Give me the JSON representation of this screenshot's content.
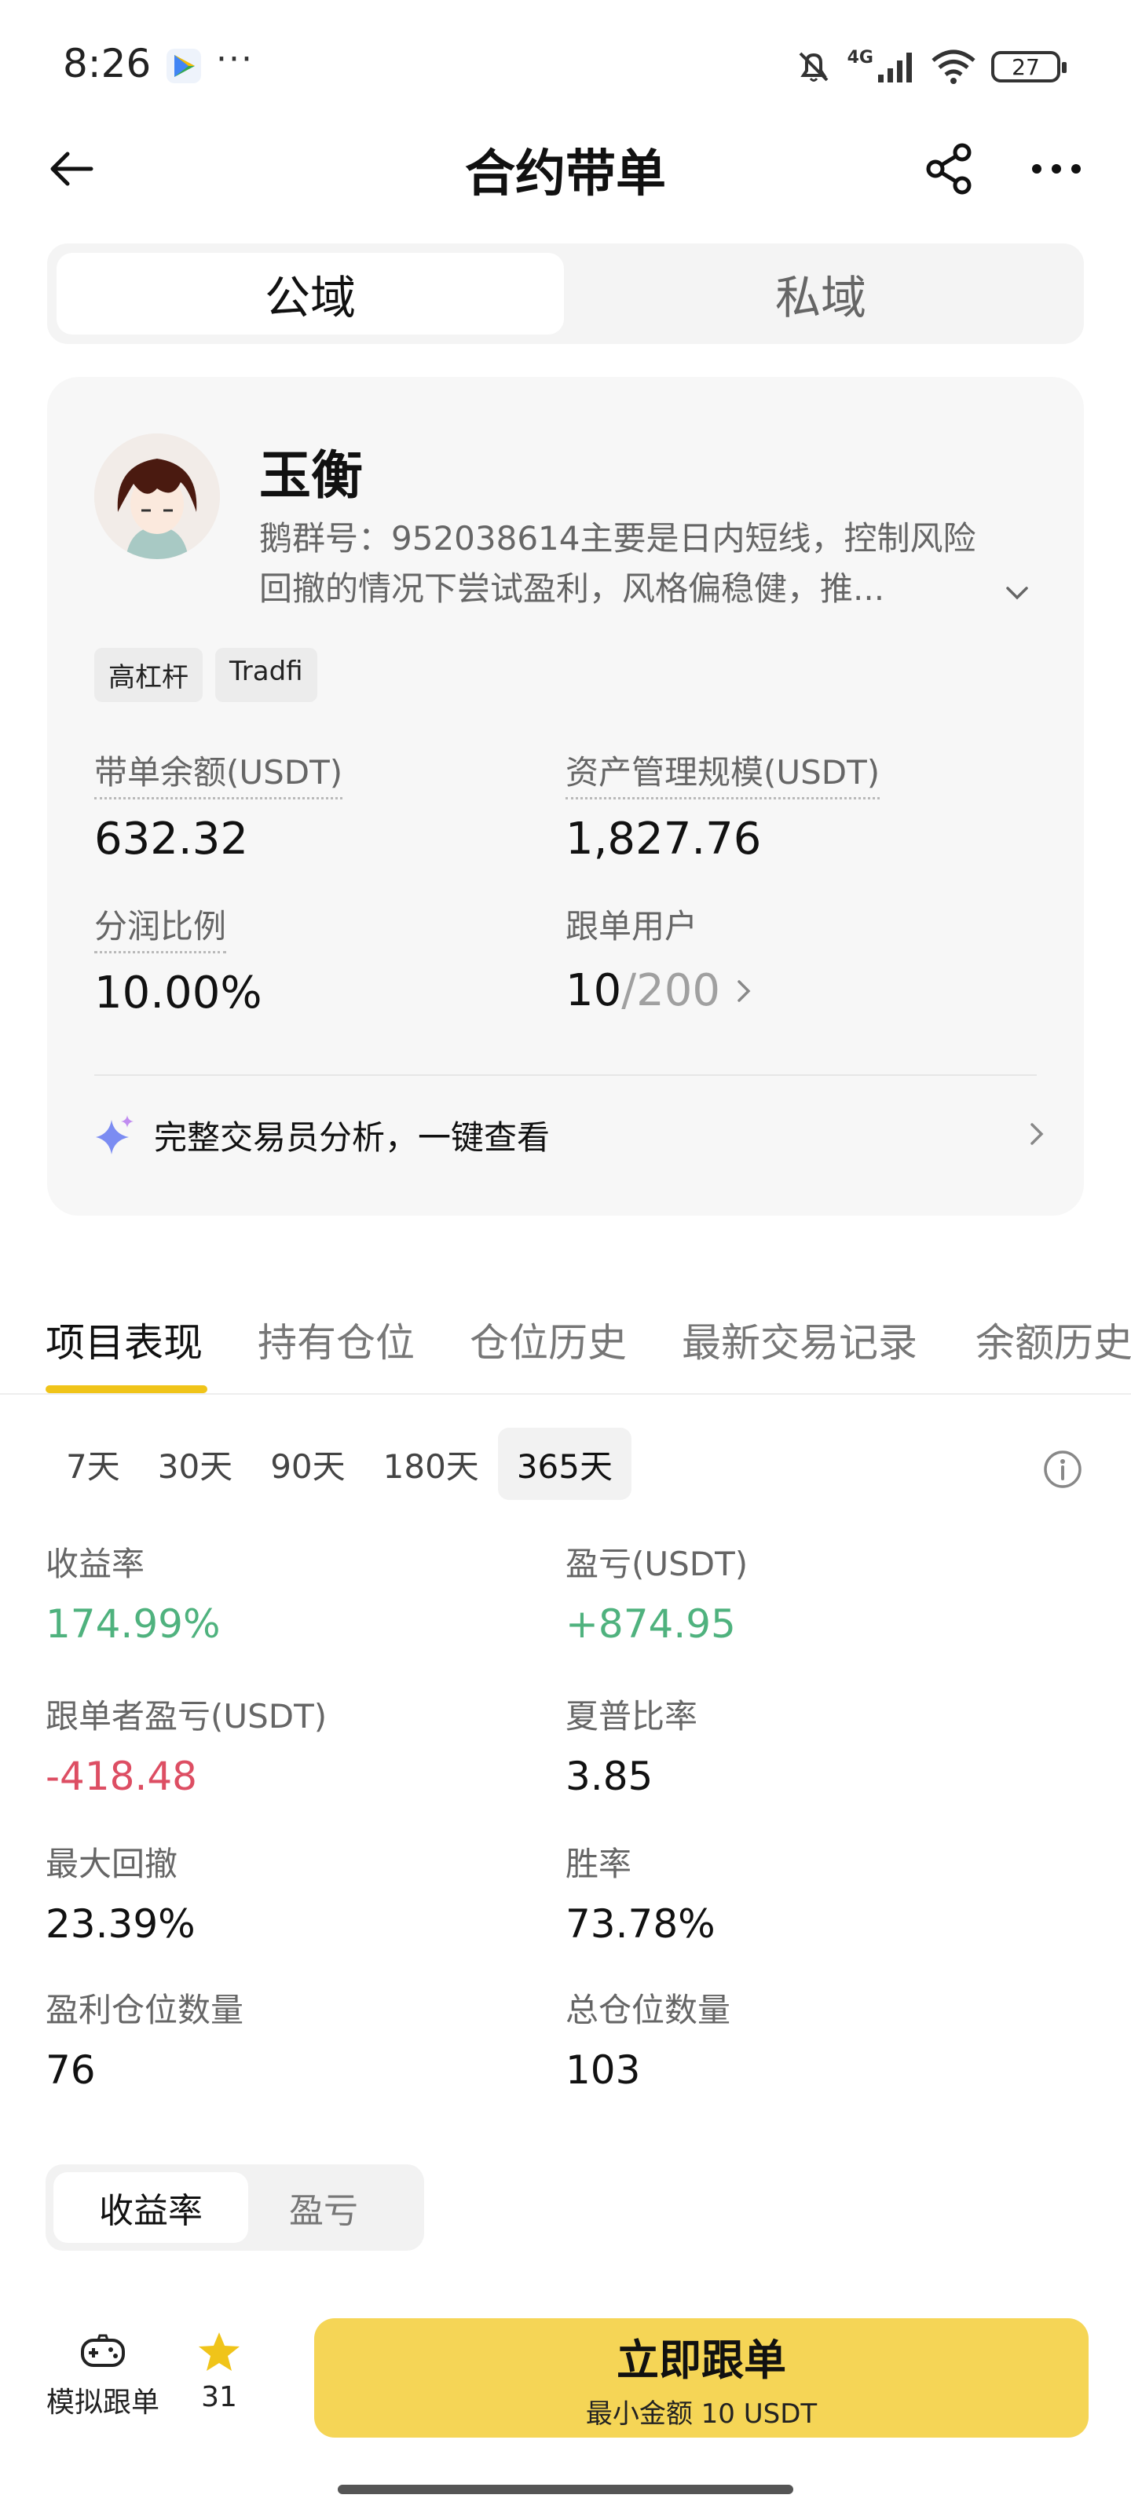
{
  "status_bar": {
    "time": "8:26",
    "more_dots": "···",
    "network": "4G",
    "battery": "27"
  },
  "header": {
    "title": "合约带单"
  },
  "segment": {
    "public": "公域",
    "private": "私域"
  },
  "trader": {
    "name": "玉衡",
    "description": "鹅群号：952038614主要是日内短线，控制风险回撤的情况下尝试盈利，风格偏稳健，推...",
    "tags": [
      "高杠杆",
      "Tradfi"
    ],
    "stats": {
      "balance_label": "带单余额(USDT)",
      "balance_value": "632.32",
      "aum_label": "资产管理规模(USDT)",
      "aum_value": "1,827.76",
      "profit_share_label": "分润比例",
      "profit_share_value": "10.00%",
      "followers_label": "跟单用户",
      "followers_value": "10",
      "followers_max": "/200"
    },
    "analysis_link": "完整交易员分析，一键查看"
  },
  "tabs": [
    "项目表现",
    "持有仓位",
    "仓位历史",
    "最新交易记录",
    "余额历史"
  ],
  "periods": [
    "7天",
    "30天",
    "90天",
    "180天",
    "365天"
  ],
  "metrics": {
    "roi_label": "收益率",
    "roi_value": "174.99%",
    "pnl_label": "盈亏(USDT)",
    "pnl_value": "+874.95",
    "follower_pnl_label": "跟单者盈亏(USDT)",
    "follower_pnl_value": "-418.48",
    "sharpe_label": "夏普比率",
    "sharpe_value": "3.85",
    "drawdown_label": "最大回撤",
    "drawdown_value": "23.39%",
    "winrate_label": "胜率",
    "winrate_value": "73.78%",
    "profit_positions_label": "盈利仓位数量",
    "profit_positions_value": "76",
    "total_positions_label": "总仓位数量",
    "total_positions_value": "103"
  },
  "chart_toggle": {
    "roi": "收益率",
    "pnl": "盈亏"
  },
  "bottom": {
    "simulate_label": "模拟跟单",
    "favorites_count": "31",
    "follow_button": "立即跟单",
    "follow_min": "最小金额 10 USDT"
  },
  "colors": {
    "accent_yellow": "#f5d556",
    "positive": "#4fb27e",
    "negative": "#dd4e63"
  }
}
